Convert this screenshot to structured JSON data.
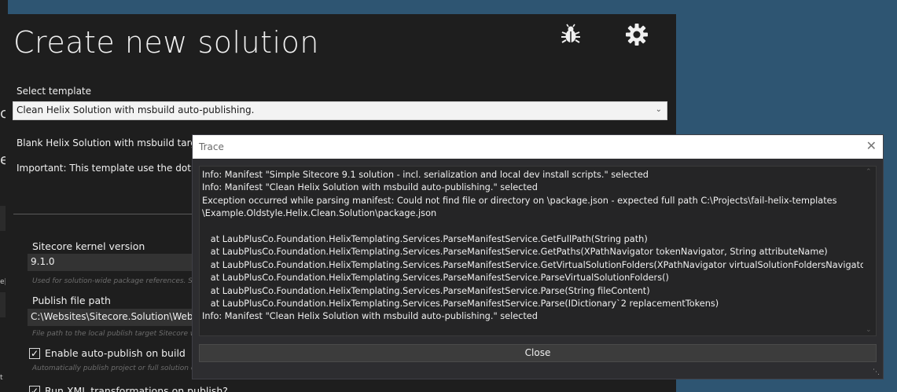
{
  "main": {
    "title": "Create new solution",
    "select_template_label": "Select template",
    "template_selected": "Clean Helix Solution with msbuild auto-publishing.",
    "description_1": "Blank Helix Solution with msbuild targets s",
    "description_2": "Important: This template use the dotnet pr",
    "kernel_label": "Sitecore kernel version",
    "kernel_value": "9.1.0",
    "kernel_hint": "Used for solution-wide package references. Se",
    "publish_label": "Publish file path",
    "publish_value": "C:\\Websites\\Sitecore.Solution\\Website",
    "publish_hint": "File path to the local publish target Sitecore w",
    "auto_publish_label": "Enable auto-publish on build",
    "auto_publish_hint": "Automatically publish project or full solution o",
    "xml_transform_label": "Run XML transformations on publish?"
  },
  "trace": {
    "title": "Trace",
    "lines": [
      "Info: Manifest \"Simple Sitecore 9.1 solution - incl. serialization and local dev install scripts.\" selected",
      "Info: Manifest \"Clean Helix Solution with msbuild auto-publishing.\" selected",
      "Exception occurred while parsing manifest: Could not find file or directory on \\package.json - expected full path C:\\Projects\\fail-helix-templates",
      "\\Example.Oldstyle.Helix.Clean.Solution\\package.json",
      "",
      "   at LaubPlusCo.Foundation.HelixTemplating.Services.ParseManifestService.GetFullPath(String path)",
      "   at LaubPlusCo.Foundation.HelixTemplating.Services.ParseManifestService.GetPaths(XPathNavigator tokenNavigator, String attributeName)",
      "   at LaubPlusCo.Foundation.HelixTemplating.Services.ParseManifestService.GetVirtualSolutionFolders(XPathNavigator virtualSolutionFoldersNavigator)",
      "   at LaubPlusCo.Foundation.HelixTemplating.Services.ParseManifestService.ParseVirtualSolutionFolders()",
      "   at LaubPlusCo.Foundation.HelixTemplating.Services.ParseManifestService.Parse(String fileContent)",
      "   at LaubPlusCo.Foundation.HelixTemplating.Services.ParseManifestService.Parse(IDictionary`2 replacementTokens)",
      "Info: Manifest \"Clean Helix Solution with msbuild auto-publishing.\" selected"
    ],
    "close_label": "Close"
  },
  "underlay": {
    "frag_1": "c",
    "frag_2": "e",
    "frag_3": "e|",
    "frag_4": "t"
  },
  "icons": {
    "bug": "bug-icon",
    "settings": "gear-icon",
    "close": "close-icon",
    "chevron": "chevron-down-icon",
    "check": "check-icon"
  },
  "colors": {
    "desktop": "#2e5572",
    "window_bg": "#1e1e1e",
    "dialog_bg": "#2d2d30",
    "titlebar": "#ffffff",
    "button_bg": "#3c3c3c"
  }
}
